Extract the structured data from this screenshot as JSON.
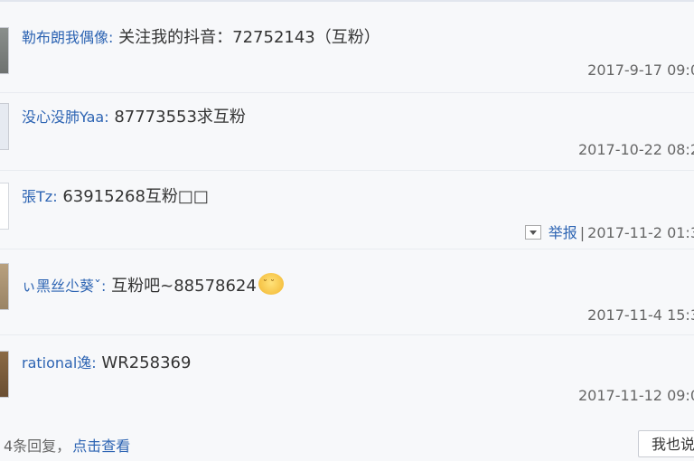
{
  "comments": [
    {
      "user": "勒布朗我偶像",
      "text": "关注我的抖音：72752143（互粉）",
      "time": "2017-9-17 09:0"
    },
    {
      "user": "没心没肺Yaa",
      "text": "87773553求互粉",
      "time": "2017-10-22 08:2"
    },
    {
      "user": "張Tz",
      "text": "63915268互粉□□",
      "time": "2017-11-2 01:3",
      "report": "举报"
    },
    {
      "user": "ぃ黑丝尐葵ˇ",
      "text": "互粉吧~88578624",
      "time": "2017-11-4 15:3",
      "emoji": "smile-emoji"
    },
    {
      "user": "rational逸",
      "text": "WR258369",
      "time": "2017-11-12 09:0"
    }
  ],
  "separator": ":",
  "footer": {
    "count_text": "4条回复，",
    "view_link": "点击查看",
    "reply_button": "我也说"
  },
  "colors": {
    "link": "#2d64b3",
    "meta": "#666666",
    "background": "#f7f8fa"
  }
}
